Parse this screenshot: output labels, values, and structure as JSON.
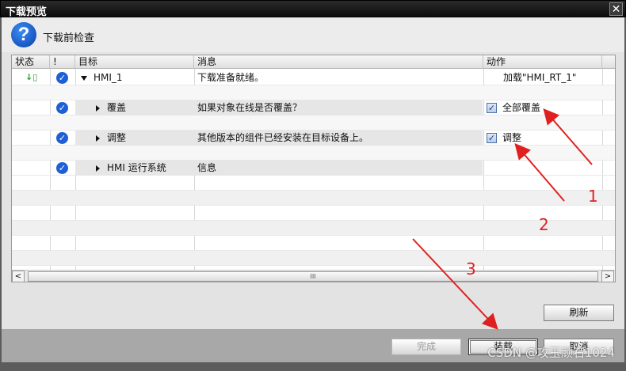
{
  "window": {
    "title": "下载预览",
    "close_glyph": "✕"
  },
  "header": {
    "label": "下载前检查",
    "icon_glyph": "?"
  },
  "columns": {
    "status": "状态",
    "flag": "!",
    "target": "目标",
    "message": "消息",
    "action": "动作"
  },
  "rows": [
    {
      "target": "HMI_1",
      "message": "下载准备就绪。",
      "action": "加载\"HMI_RT_1\"",
      "status_glyph": "↓▯"
    },
    {
      "target": "覆盖",
      "message": "如果对象在线是否覆盖？",
      "action": "全部覆盖",
      "checked": true
    },
    {
      "target": "调整",
      "message": "其他版本的组件已经安装在目标设备上。",
      "action": "调整",
      "checked": true
    },
    {
      "target": "HMI 运行系统",
      "message": "信息",
      "action": ""
    }
  ],
  "glyphs": {
    "ok": "✓",
    "check": "✓",
    "scroll_left": "<",
    "scroll_right": ">",
    "thumb_grip": "III"
  },
  "buttons": {
    "refresh": "刷新",
    "finish": "完成",
    "load": "装载",
    "cancel": "取消"
  },
  "annotations": {
    "a1": "1",
    "a2": "2",
    "a3": "3"
  },
  "watermark": "CSDN @攻玉顽石1024",
  "colors": {
    "annotation": "#e02020",
    "ok_icon": "#1f5fd6",
    "titlebar": "#111111"
  }
}
